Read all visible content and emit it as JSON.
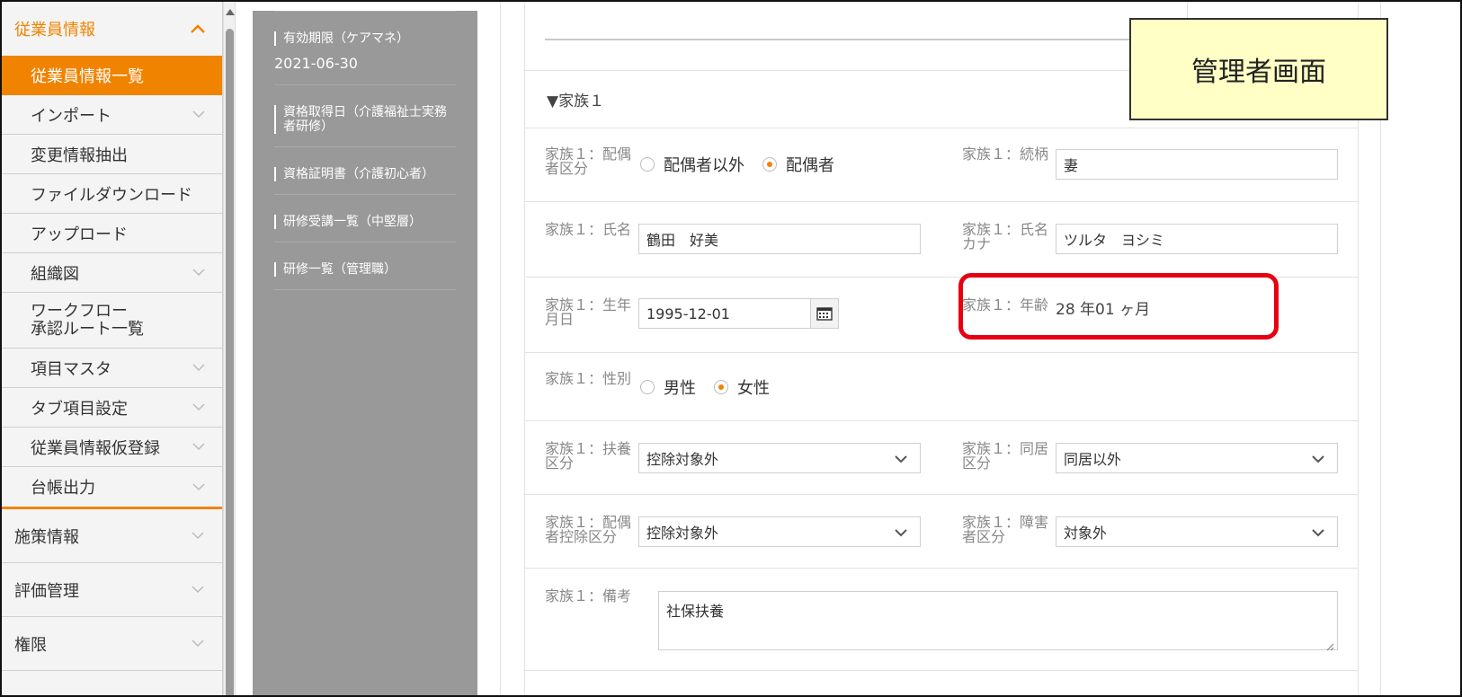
{
  "sidebar": {
    "employee_section": "従業員情報",
    "items": [
      {
        "label": "従業員情報一覧"
      },
      {
        "label": "インポート"
      },
      {
        "label": "変更情報抽出"
      },
      {
        "label": "ファイルダウンロード"
      },
      {
        "label": "アップロード"
      },
      {
        "label": "組織図"
      },
      {
        "label": "ワークフロー",
        "label2": "承認ルート一覧"
      },
      {
        "label": "項目マスタ"
      },
      {
        "label": "タブ項目設定"
      },
      {
        "label": "従業員情報仮登録"
      },
      {
        "label": "台帳出力"
      }
    ],
    "sections": [
      "施策情報",
      "評価管理",
      "権限"
    ]
  },
  "docs": [
    {
      "label": "有効期限（ケアマネ）",
      "value": "2021-06-30"
    },
    {
      "label": "資格取得日（介護福祉士実務者研修）"
    },
    {
      "label": "資格証明書（介護初心者）"
    },
    {
      "label": "研修受講一覧（中堅層）"
    },
    {
      "label": "研修一覧（管理職）"
    }
  ],
  "form": {
    "family_title": "▼家族１",
    "spouse_class_label": "家族１：配偶者区分",
    "spouse_options": [
      "配偶者以外",
      "配偶者"
    ],
    "spouse_selected": "配偶者",
    "relation_label": "家族１：続柄",
    "relation_value": "妻",
    "name_label": "家族１：氏名",
    "name_value": "鶴田　好美",
    "kana_label": "家族１：氏名カナ",
    "kana_value": "ツルタ　ヨシミ",
    "birth_label": "家族１：生年月日",
    "birth_value": "1995-12-01",
    "age_label": "家族１：年齢",
    "age_value": "28 年01 ヶ月",
    "gender_label": "家族１：性別",
    "gender_options": [
      "男性",
      "女性"
    ],
    "gender_selected": "女性",
    "dependent_label": "家族１：扶養区分",
    "dependent_value": "控除対象外",
    "cohabit_label": "家族１：同居区分",
    "cohabit_value": "同居以外",
    "spouse_deduction_label": "家族１：配偶者控除区分",
    "spouse_deduction_value": "控除対象外",
    "disability_label": "家族１：障害者区分",
    "disability_value": "対象外",
    "remarks_label": "家族１：備考",
    "remarks_value": "社保扶養"
  },
  "callout": "管理者画面",
  "colors": {
    "accent": "#f08300",
    "highlight": "#e60012",
    "panel": "#999999",
    "callout_bg": "#ffffc6"
  }
}
